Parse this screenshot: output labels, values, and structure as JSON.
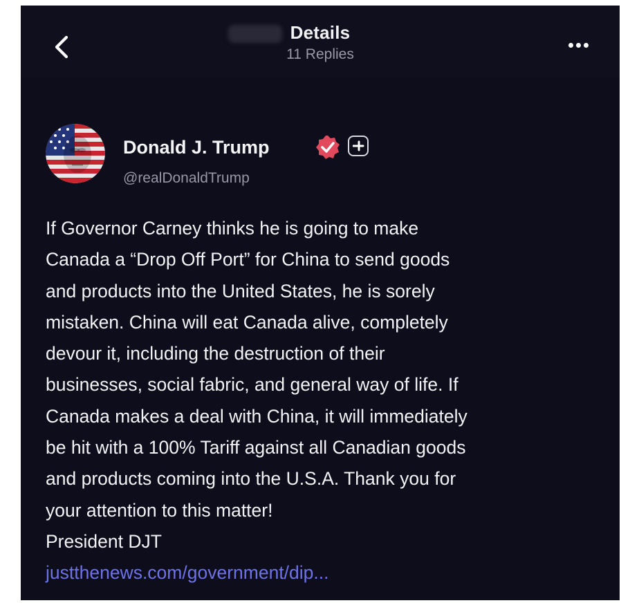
{
  "header": {
    "title": "Details",
    "subtitle": "11 Replies",
    "back_icon": "chevron-left-icon",
    "more_icon": "more-horizontal-icon"
  },
  "post": {
    "author_name": "Donald J. Trump",
    "handle": "@realDonaldTrump",
    "verified_color": "#e2495d",
    "lines": [
      "If Governor Carney thinks he is going to make",
      "Canada a “Drop Off Port” for China to send goods",
      "and products into the United States, he is sorely",
      "mistaken. China will eat Canada alive, completely",
      "devour it, including the destruction of their",
      "businesses, social fabric, and general way of life. If",
      "Canada makes a deal with China, it will immediately",
      "be hit with a 100% Tariff against all Canadian goods",
      "and products coming into the U.S.A. Thank you for",
      "your attention to this matter!"
    ],
    "signature": "President DJT",
    "link_text": "justthenews.com/government/dip...",
    "link_color": "#6e72e8"
  },
  "colors": {
    "background": "#0e0d1b",
    "text": "#f3f3f6",
    "muted": "#9897a7"
  }
}
